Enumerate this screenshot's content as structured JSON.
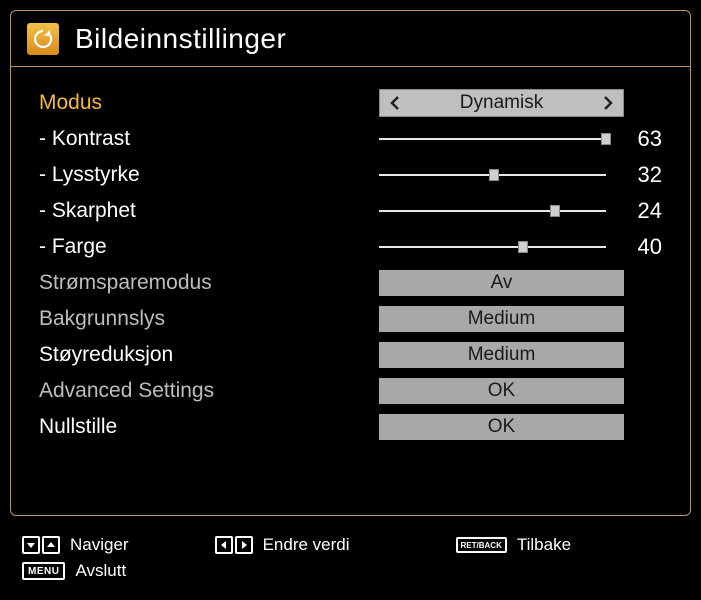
{
  "title": "Bildeinnstillinger",
  "rows": {
    "modus": {
      "label": "Modus",
      "value": "Dynamisk"
    },
    "kontrast": {
      "label": "- Kontrast",
      "value": 63,
      "max": 63
    },
    "lysstyrke": {
      "label": "- Lysstyrke",
      "value": 32,
      "max": 63
    },
    "skarphet": {
      "label": "- Skarphet",
      "value": 24,
      "max": 31
    },
    "farge": {
      "label": "- Farge",
      "value": 40,
      "max": 63
    },
    "stromspare": {
      "label": "Strømsparemodus",
      "value": "Av"
    },
    "bakgrunnslys": {
      "label": "Bakgrunnslys",
      "value": "Medium"
    },
    "stoyreduksjon": {
      "label": "Støyreduksjon",
      "value": "Medium"
    },
    "advanced": {
      "label": "Advanced Settings",
      "value": "OK"
    },
    "nullstille": {
      "label": "Nullstille",
      "value": "OK"
    }
  },
  "footer": {
    "naviger": "Naviger",
    "endre": "Endre verdi",
    "tilbake": "Tilbake",
    "avslutt": "Avslutt",
    "menu_key": "MENU",
    "retback_key": "RET/BACK"
  }
}
